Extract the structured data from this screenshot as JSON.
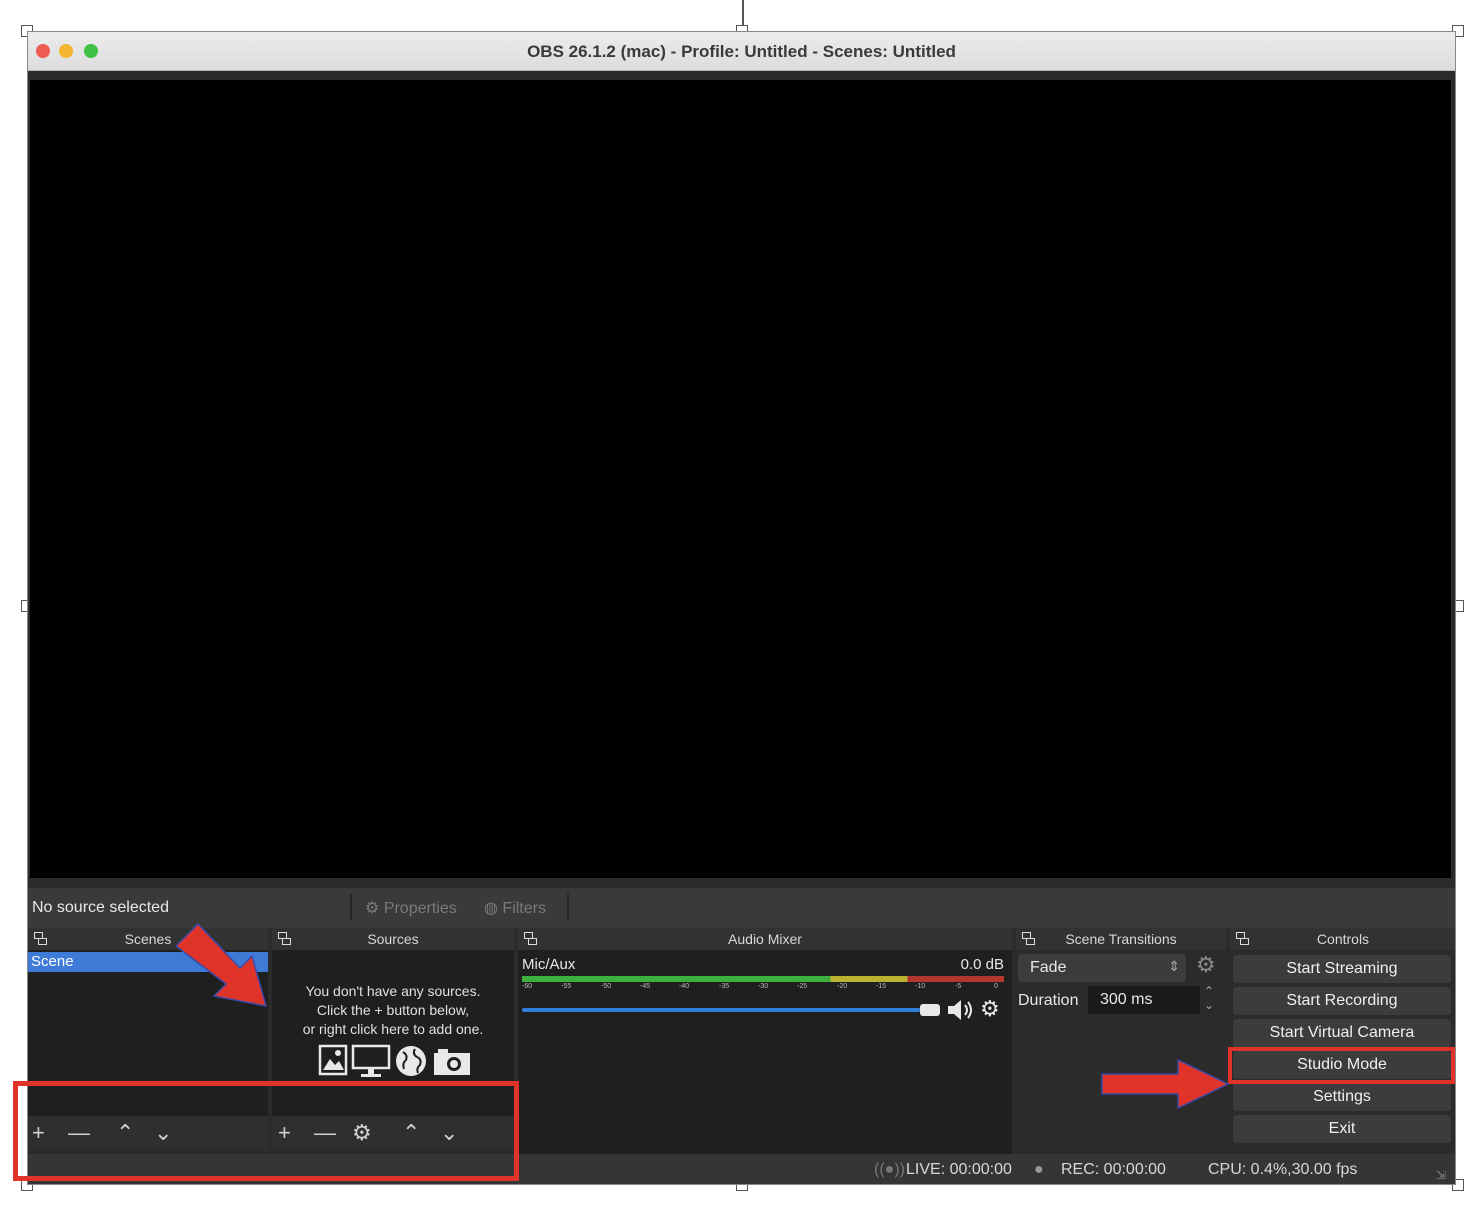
{
  "window": {
    "title": "OBS 26.1.2 (mac) - Profile: Untitled - Scenes: Untitled"
  },
  "source_toolbar": {
    "no_source": "No source selected",
    "properties": "Properties",
    "filters": "Filters"
  },
  "docks": {
    "scenes": "Scenes",
    "sources": "Sources",
    "audio_mixer": "Audio Mixer",
    "scene_transitions": "Scene Transitions",
    "controls": "Controls"
  },
  "scenes": {
    "items": [
      "Scene"
    ]
  },
  "sources": {
    "empty_line1": "You don't have any sources.",
    "empty_line2": "Click the + button below,",
    "empty_line3": "or right click here to add one."
  },
  "audio_mixer": {
    "channel_name": "Mic/Aux",
    "level": "0.0 dB",
    "scale": [
      "-60",
      "-55",
      "-50",
      "-45",
      "-40",
      "-35",
      "-30",
      "-25",
      "-20",
      "-15",
      "-10",
      "-5",
      "0"
    ],
    "volume": 1.0
  },
  "transitions": {
    "selected": "Fade",
    "duration_label": "Duration",
    "duration_value": "300 ms"
  },
  "controls": {
    "start_streaming": "Start Streaming",
    "start_recording": "Start Recording",
    "start_virtual_camera": "Start Virtual Camera",
    "studio_mode": "Studio Mode",
    "settings": "Settings",
    "exit": "Exit"
  },
  "status": {
    "live": "LIVE: 00:00:00",
    "rec": "REC: 00:00:00",
    "cpu": "CPU: 0.4%,30.00 fps"
  },
  "icons": [
    "image-icon",
    "display-icon",
    "globe-icon",
    "camera-icon",
    "gear-icon",
    "plus-icon",
    "minus-icon",
    "arrow-up-icon",
    "arrow-down-icon",
    "speaker-icon",
    "broadcast-icon"
  ],
  "colors": {
    "annotation": "#e0342a",
    "selection": "#3e7bd6",
    "meter_green": "#3fbf3f",
    "volume_blue": "#2f7fd8"
  }
}
